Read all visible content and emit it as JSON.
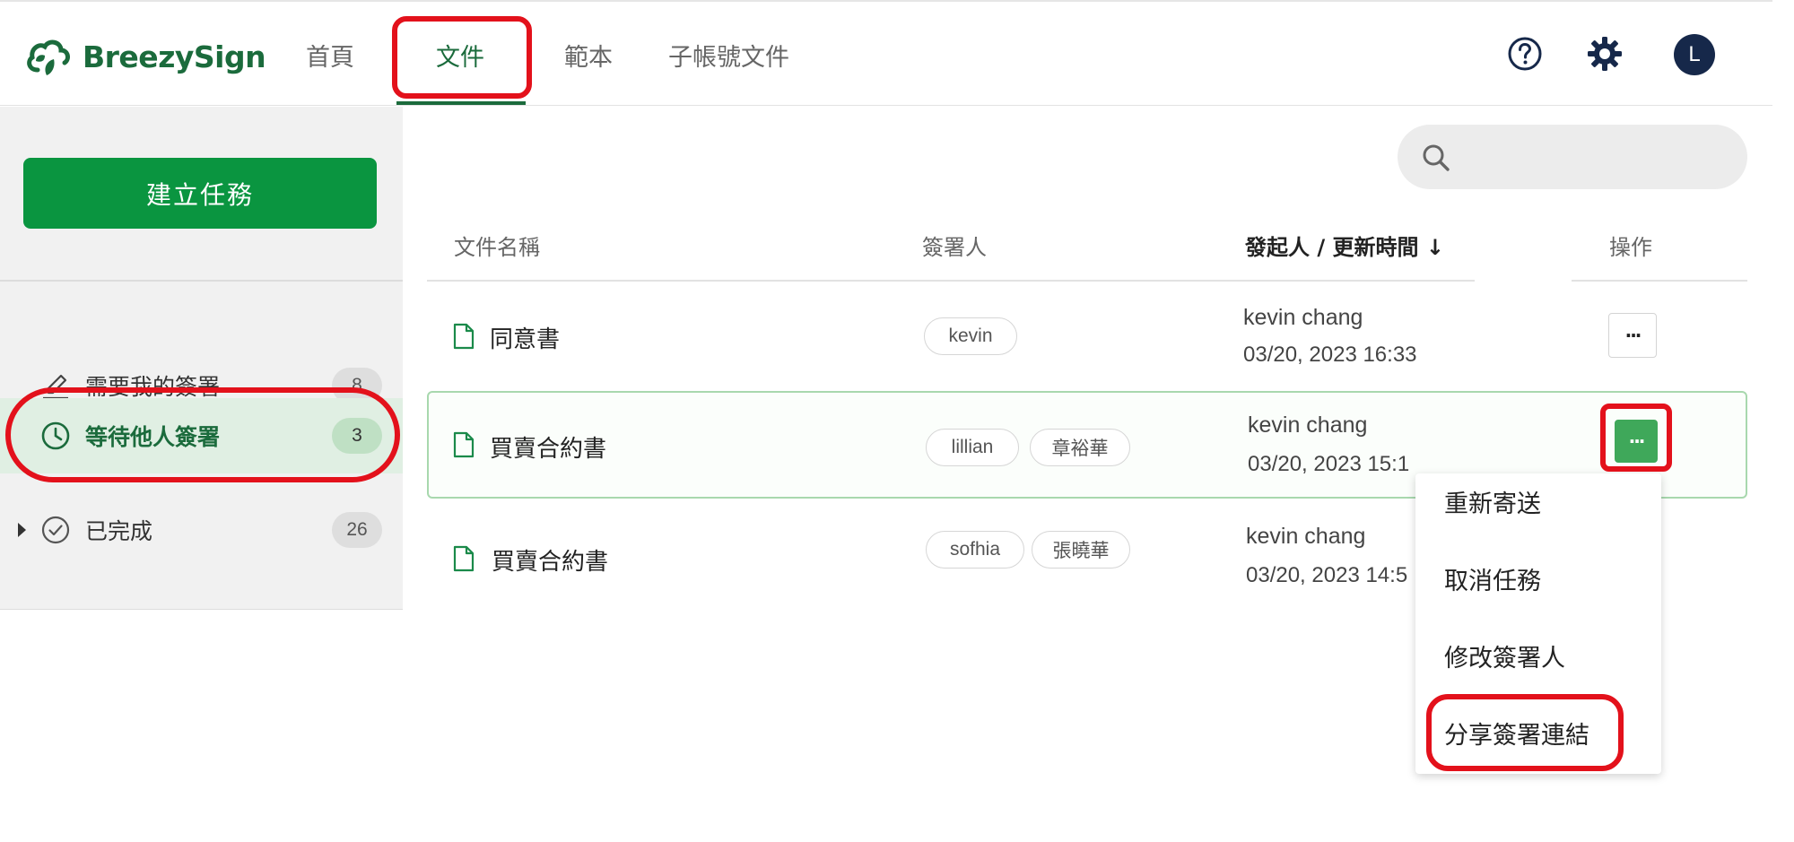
{
  "app": {
    "brand": "BreezySign",
    "brand_color": "#1b6b3c",
    "accent_color": "#0a9540",
    "highlight_color": "#e3111b"
  },
  "nav": {
    "tabs": [
      {
        "label": "首頁",
        "active": false
      },
      {
        "label": "文件",
        "active": true
      },
      {
        "label": "範本",
        "active": false
      },
      {
        "label": "子帳號文件",
        "active": false
      }
    ],
    "icons": [
      "help-icon",
      "gear-icon"
    ],
    "avatar_initial": "L"
  },
  "sidebar": {
    "create_button": "建立任務",
    "items": [
      {
        "label": "需要我的簽署",
        "count": "8",
        "icon": "pen-icon",
        "active": false
      },
      {
        "label": "等待他人簽署",
        "count": "3",
        "icon": "clock-icon",
        "active": true
      },
      {
        "label": "已完成",
        "count": "26",
        "icon": "check-circle-icon",
        "active": false
      }
    ]
  },
  "search": {
    "placeholder": ""
  },
  "table": {
    "headers": {
      "name": "文件名稱",
      "signers": "簽署人",
      "sender_time": "發起人 / 更新時間",
      "sort_arrow": "↓",
      "actions": "操作"
    },
    "rows": [
      {
        "name": "同意書",
        "signers": [
          "kevin"
        ],
        "sender": "kevin chang",
        "time": "03/20, 2023 16:33"
      },
      {
        "name": "買賣合約書",
        "signers": [
          "lillian",
          "章裕華"
        ],
        "sender": "kevin chang",
        "time": "03/20, 2023 15:1"
      },
      {
        "name": "買賣合約書",
        "signers": [
          "sofhia",
          "張曉華"
        ],
        "sender": "kevin chang",
        "time": "03/20, 2023 14:5"
      }
    ],
    "more_label": "···"
  },
  "menu": {
    "items": [
      "重新寄送",
      "取消任務",
      "修改簽署人",
      "分享簽署連結"
    ]
  }
}
